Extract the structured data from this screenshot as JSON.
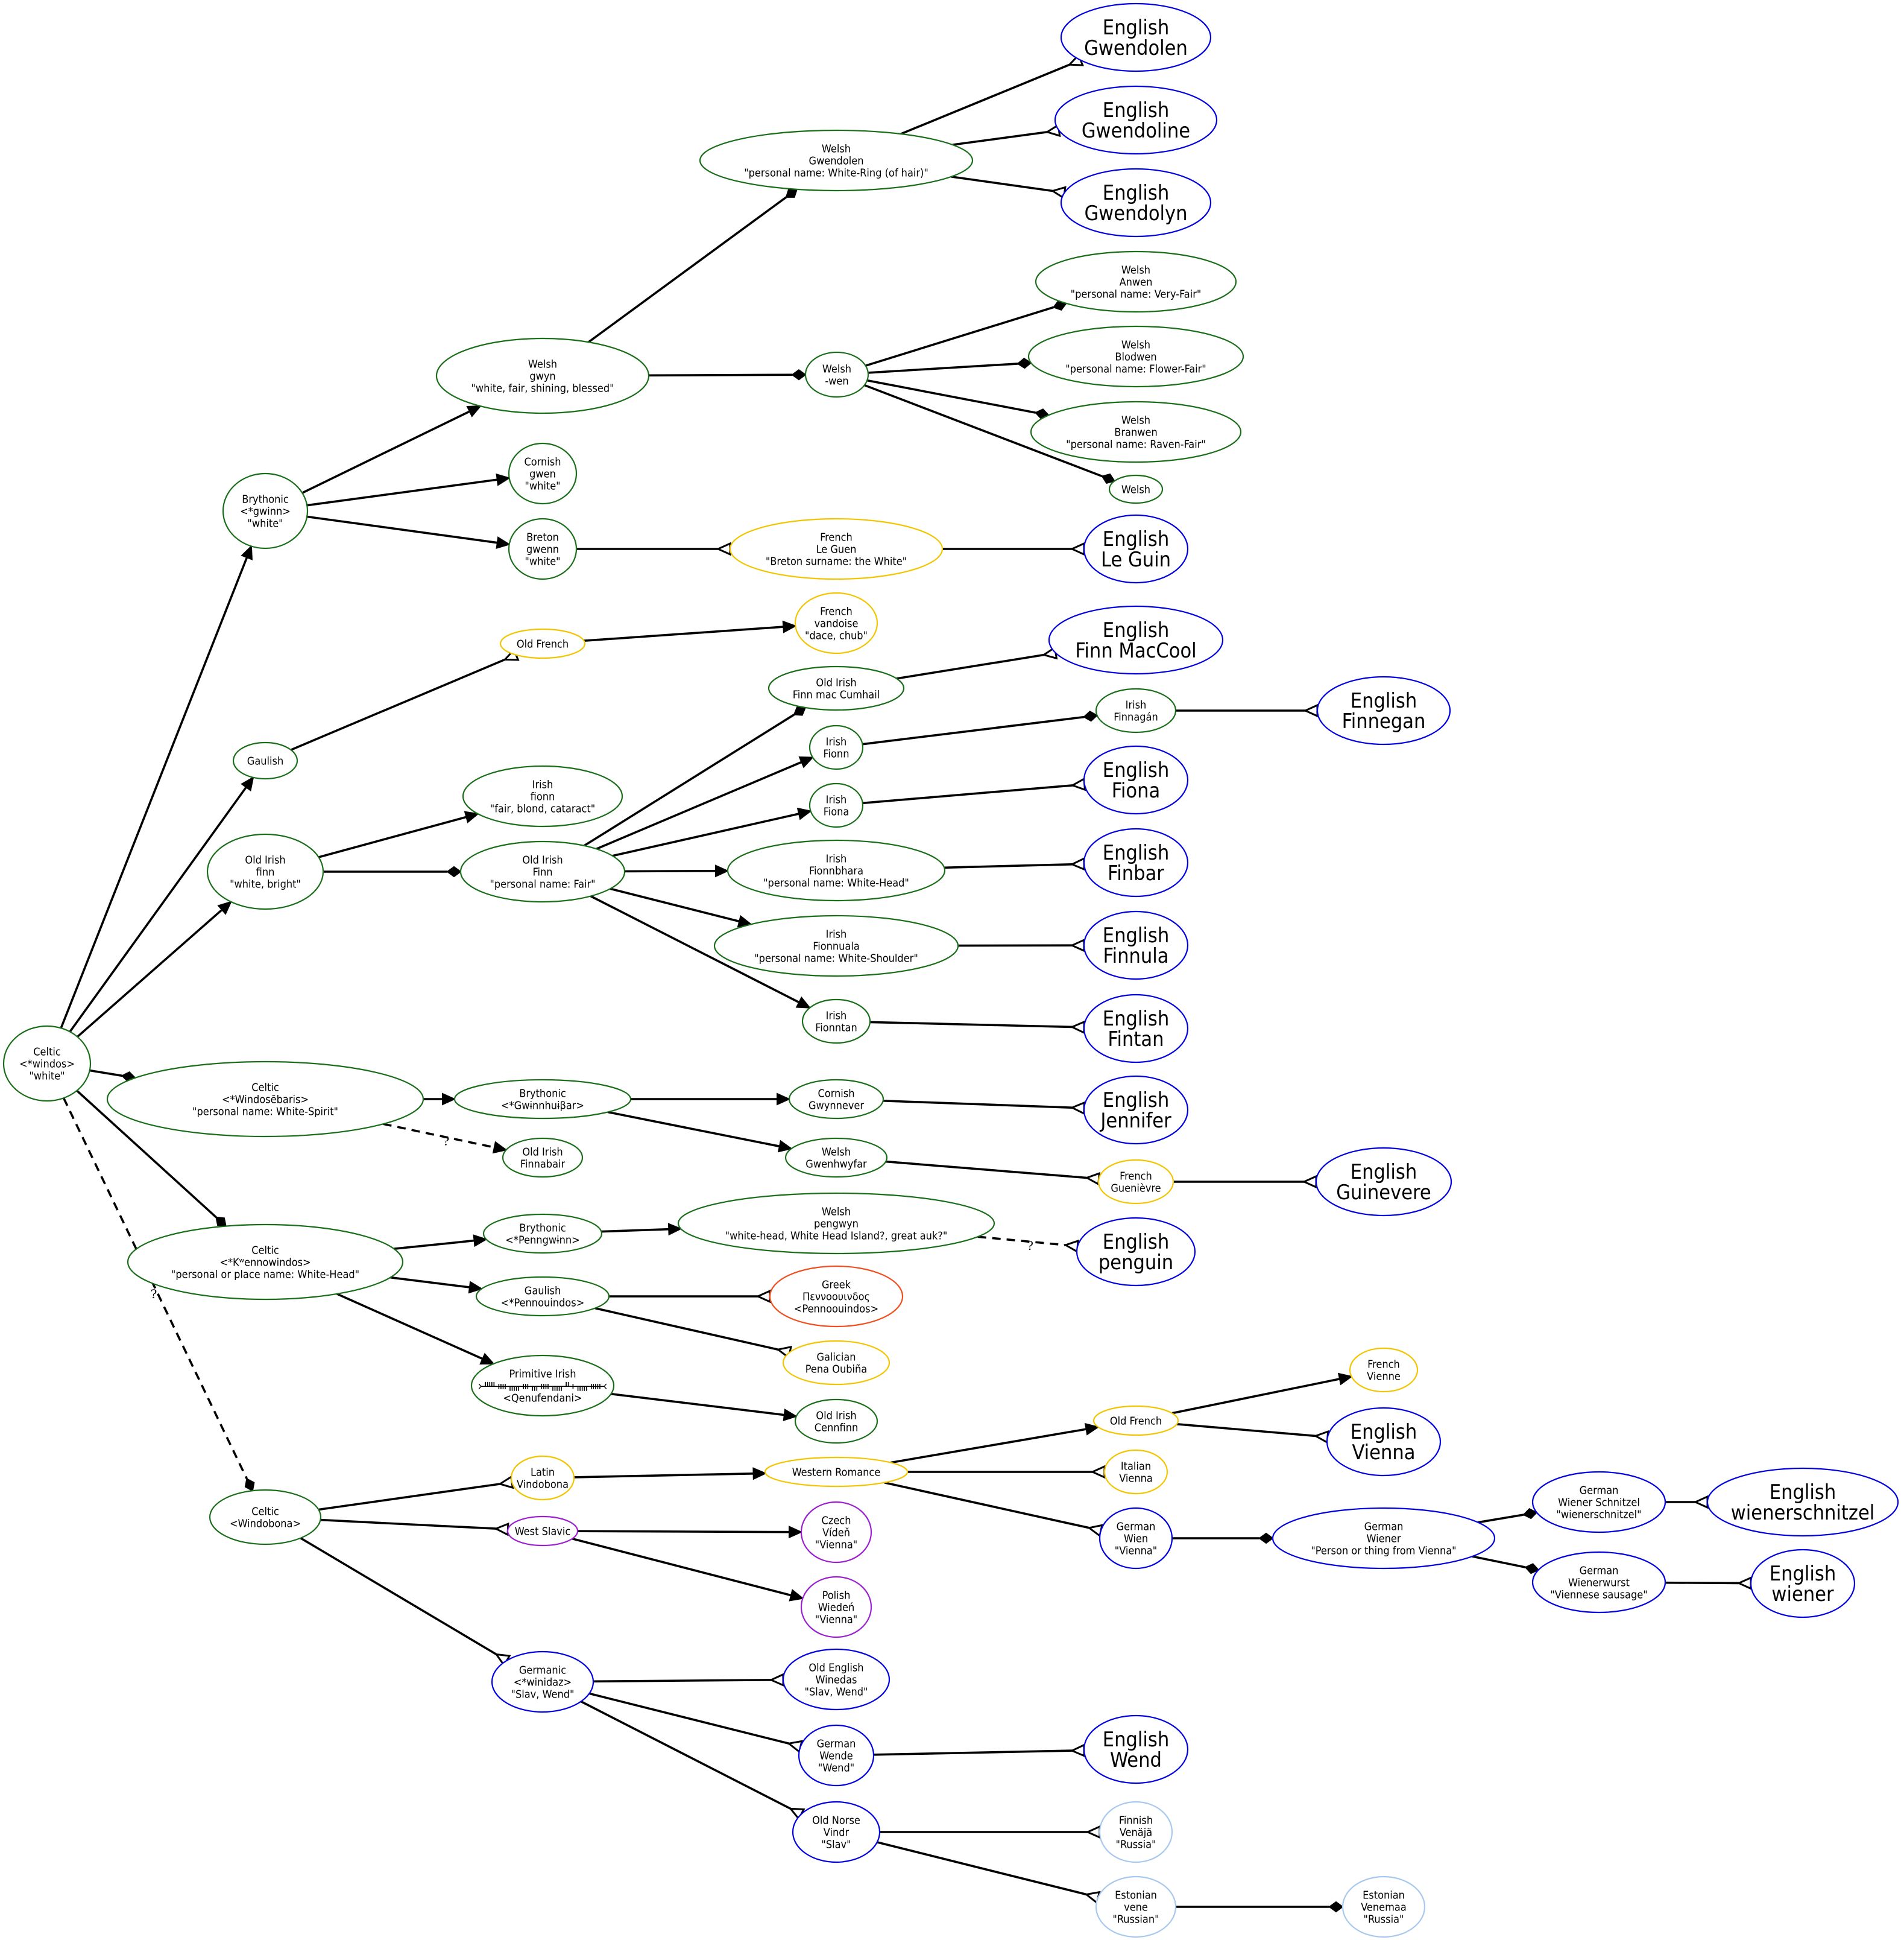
{
  "colors": {
    "celtic": "#1a6e1a",
    "romance": "#f2c500",
    "germanic": "#0000e0",
    "slavic": "#9b1fd0",
    "greek": "#f05020",
    "finnic": "#a8c8ee",
    "edge": "#000000"
  },
  "nodes": [
    {
      "id": "celtic_windos",
      "group": "celtic",
      "lines": [
        "Celtic",
        "<*windos>",
        "\"white\""
      ]
    },
    {
      "id": "bry_gwinn",
      "group": "celtic",
      "lines": [
        "Brythonic",
        "<*gwinn>",
        "\"white\""
      ]
    },
    {
      "id": "gaulish",
      "group": "celtic",
      "lines": [
        "Gaulish"
      ]
    },
    {
      "id": "oi_finn",
      "group": "celtic",
      "lines": [
        "Old Irish",
        "finn",
        "\"white, bright\""
      ]
    },
    {
      "id": "celtic_windoseb",
      "group": "celtic",
      "lines": [
        "Celtic",
        "<*Windosēbaris>",
        "\"personal name: White-Spirit\""
      ]
    },
    {
      "id": "celtic_kwenno",
      "group": "celtic",
      "lines": [
        "Celtic",
        "<*Kʷennowindos>",
        "\"personal or place name: White-Head\""
      ]
    },
    {
      "id": "celtic_windobona",
      "group": "celtic",
      "lines": [
        "Celtic",
        "<Windobona>"
      ]
    },
    {
      "id": "welsh_gwyn",
      "group": "celtic",
      "lines": [
        "Welsh",
        "gwyn",
        "\"white, fair, shining, blessed\""
      ]
    },
    {
      "id": "cornish_gwen",
      "group": "celtic",
      "lines": [
        "Cornish",
        "gwen",
        "\"white\""
      ]
    },
    {
      "id": "breton_gwenn",
      "group": "celtic",
      "lines": [
        "Breton",
        "gwenn",
        "\"white\""
      ]
    },
    {
      "id": "welsh_gwendolen",
      "group": "celtic",
      "lines": [
        "Welsh",
        "Gwendolen",
        "\"personal name: White-Ring (of hair)\""
      ]
    },
    {
      "id": "welsh_wen",
      "group": "celtic",
      "lines": [
        "Welsh",
        "-wen"
      ]
    },
    {
      "id": "eng_gwendolen",
      "group": "germanic",
      "big": true,
      "lines": [
        "English",
        "Gwendolen"
      ]
    },
    {
      "id": "eng_gwendoline",
      "group": "germanic",
      "big": true,
      "lines": [
        "English",
        "Gwendoline"
      ]
    },
    {
      "id": "eng_gwendolyn",
      "group": "germanic",
      "big": true,
      "lines": [
        "English",
        "Gwendolyn"
      ]
    },
    {
      "id": "welsh_anwen",
      "group": "celtic",
      "lines": [
        "Welsh",
        "Anwen",
        "\"personal name: Very-Fair\""
      ]
    },
    {
      "id": "welsh_blodwen",
      "group": "celtic",
      "lines": [
        "Welsh",
        "Blodwen",
        "\"personal name: Flower-Fair\""
      ]
    },
    {
      "id": "welsh_branwen",
      "group": "celtic",
      "lines": [
        "Welsh",
        "Branwen",
        "\"personal name: Raven-Fair\""
      ]
    },
    {
      "id": "welsh_plain",
      "group": "celtic",
      "lines": [
        "Welsh"
      ]
    },
    {
      "id": "french_leguen",
      "group": "romance",
      "lines": [
        "French",
        "Le Guen",
        "\"Breton surname: the White\""
      ]
    },
    {
      "id": "eng_leguin",
      "group": "germanic",
      "big": true,
      "lines": [
        "English",
        "Le Guin"
      ]
    },
    {
      "id": "ofr_1",
      "group": "romance",
      "lines": [
        "Old French"
      ]
    },
    {
      "id": "fr_vandoise",
      "group": "romance",
      "lines": [
        "French",
        "vandoise",
        "\"dace, chub\""
      ]
    },
    {
      "id": "irish_fionn_adj",
      "group": "celtic",
      "lines": [
        "Irish",
        "fionn",
        "\"fair, blond, cataract\""
      ]
    },
    {
      "id": "oi_Finn",
      "group": "celtic",
      "lines": [
        "Old Irish",
        "Finn",
        "\"personal name: Fair\""
      ]
    },
    {
      "id": "oi_finnmac",
      "group": "celtic",
      "lines": [
        "Old Irish",
        "Finn mac Cumhail"
      ]
    },
    {
      "id": "irish_fionn",
      "group": "celtic",
      "lines": [
        "Irish",
        "Fionn"
      ]
    },
    {
      "id": "irish_fiona",
      "group": "celtic",
      "lines": [
        "Irish",
        "Fiona"
      ]
    },
    {
      "id": "irish_fionnbhara",
      "group": "celtic",
      "lines": [
        "Irish",
        "Fionnbhara",
        "\"personal name: White-Head\""
      ]
    },
    {
      "id": "irish_fionnuala",
      "group": "celtic",
      "lines": [
        "Irish",
        "Fionnuala",
        "\"personal name: White-Shoulder\""
      ]
    },
    {
      "id": "irish_fionntan",
      "group": "celtic",
      "lines": [
        "Irish",
        "Fionntan"
      ]
    },
    {
      "id": "eng_finnmaccool",
      "group": "germanic",
      "big": true,
      "lines": [
        "English",
        "Finn MacCool"
      ]
    },
    {
      "id": "irish_finnagan",
      "group": "celtic",
      "lines": [
        "Irish",
        "Finnagán"
      ]
    },
    {
      "id": "eng_finnegan",
      "group": "germanic",
      "big": true,
      "lines": [
        "English",
        "Finnegan"
      ]
    },
    {
      "id": "eng_fiona",
      "group": "germanic",
      "big": true,
      "lines": [
        "English",
        "Fiona"
      ]
    },
    {
      "id": "eng_finbar",
      "group": "germanic",
      "big": true,
      "lines": [
        "English",
        "Finbar"
      ]
    },
    {
      "id": "eng_finnula",
      "group": "germanic",
      "big": true,
      "lines": [
        "English",
        "Finnula"
      ]
    },
    {
      "id": "eng_fintan",
      "group": "germanic",
      "big": true,
      "lines": [
        "English",
        "Fintan"
      ]
    },
    {
      "id": "bry_gwinnhuibar",
      "group": "celtic",
      "lines": [
        "Brythonic",
        "<*Gwɨnnhuɨβar>"
      ]
    },
    {
      "id": "oi_finnabair",
      "group": "celtic",
      "lines": [
        "Old Irish",
        "Finnabair"
      ]
    },
    {
      "id": "cornish_gwynnever",
      "group": "celtic",
      "lines": [
        "Cornish",
        "Gwynnever"
      ]
    },
    {
      "id": "welsh_gwenhwyfar",
      "group": "celtic",
      "lines": [
        "Welsh",
        "Gwenhwyfar"
      ]
    },
    {
      "id": "eng_jennifer",
      "group": "germanic",
      "big": true,
      "lines": [
        "English",
        "Jennifer"
      ]
    },
    {
      "id": "fr_guenievre",
      "group": "romance",
      "lines": [
        "French",
        "Guenièvre"
      ]
    },
    {
      "id": "eng_guinevere",
      "group": "germanic",
      "big": true,
      "lines": [
        "English",
        "Guinevere"
      ]
    },
    {
      "id": "bry_penngwinn",
      "group": "celtic",
      "lines": [
        "Brythonic",
        "<*Penngwɨnn>"
      ]
    },
    {
      "id": "welsh_pengwyn",
      "group": "celtic",
      "lines": [
        "Welsh",
        "pengwyn",
        "\"white-head, White Head Island?, great auk?\""
      ]
    },
    {
      "id": "eng_penguin",
      "group": "germanic",
      "big": true,
      "lines": [
        "English",
        "penguin"
      ]
    },
    {
      "id": "gaulish_pennouindos",
      "group": "celtic",
      "lines": [
        "Gaulish",
        "<*Pennouindos>"
      ]
    },
    {
      "id": "greek_pennoouindos",
      "group": "greek",
      "lines": [
        "Greek",
        "Πεννοουινδος",
        "<Pennoouindos>"
      ]
    },
    {
      "id": "galician_pena",
      "group": "romance",
      "lines": [
        "Galician",
        "Pena Oubiña"
      ]
    },
    {
      "id": "prim_irish",
      "group": "celtic",
      "lines": [
        "Primitive Irish",
        "᚛ᚊᚓᚅᚒᚃᚓᚅᚇᚐᚅᚔ᚜",
        "<Qenufendani>"
      ]
    },
    {
      "id": "oi_cennfinn",
      "group": "celtic",
      "lines": [
        "Old Irish",
        "Cennfinn"
      ]
    },
    {
      "id": "latin_vindobona",
      "group": "romance",
      "lines": [
        "Latin",
        "Vindobona"
      ]
    },
    {
      "id": "west_slavic",
      "group": "slavic",
      "lines": [
        "West Slavic"
      ]
    },
    {
      "id": "germanic_winidaz",
      "group": "germanic",
      "lines": [
        "Germanic",
        "<*winidaz>",
        "\"Slav, Wend\""
      ]
    },
    {
      "id": "western_romance",
      "group": "romance",
      "lines": [
        "Western Romance"
      ]
    },
    {
      "id": "czech_viden",
      "group": "slavic",
      "lines": [
        "Czech",
        "Vídeň",
        "\"Vienna\""
      ]
    },
    {
      "id": "polish_wieden",
      "group": "slavic",
      "lines": [
        "Polish",
        "Wiedeń",
        "\"Vienna\""
      ]
    },
    {
      "id": "ofr_2",
      "group": "romance",
      "lines": [
        "Old French"
      ]
    },
    {
      "id": "italian_vienna",
      "group": "romance",
      "lines": [
        "Italian",
        "Vienna"
      ]
    },
    {
      "id": "german_wien",
      "group": "germanic",
      "lines": [
        "German",
        "Wien",
        "\"Vienna\""
      ]
    },
    {
      "id": "fr_vienne",
      "group": "romance",
      "lines": [
        "French",
        "Vienne"
      ]
    },
    {
      "id": "eng_vienna",
      "group": "germanic",
      "big": true,
      "lines": [
        "English",
        "Vienna"
      ]
    },
    {
      "id": "german_wiener",
      "group": "germanic",
      "lines": [
        "German",
        "Wiener",
        "\"Person or thing from Vienna\""
      ]
    },
    {
      "id": "german_schnitzel",
      "group": "germanic",
      "lines": [
        "German",
        "Wiener Schnitzel",
        "\"wienerschnitzel\""
      ]
    },
    {
      "id": "german_wienerwurst",
      "group": "germanic",
      "lines": [
        "German",
        "Wienerwurst",
        "\"Viennese sausage\""
      ]
    },
    {
      "id": "eng_wienerschnitzel",
      "group": "germanic",
      "big": true,
      "lines": [
        "English",
        "wienerschnitzel"
      ]
    },
    {
      "id": "eng_wiener",
      "group": "germanic",
      "big": true,
      "lines": [
        "English",
        "wiener"
      ]
    },
    {
      "id": "oe_winedas",
      "group": "germanic",
      "lines": [
        "Old English",
        "Winedas",
        "\"Slav, Wend\""
      ]
    },
    {
      "id": "german_wende",
      "group": "germanic",
      "lines": [
        "German",
        "Wende",
        "\"Wend\""
      ]
    },
    {
      "id": "on_vindr",
      "group": "germanic",
      "lines": [
        "Old Norse",
        "Vindr",
        "\"Slav\""
      ]
    },
    {
      "id": "eng_wend",
      "group": "germanic",
      "big": true,
      "lines": [
        "English",
        "Wend"
      ]
    },
    {
      "id": "finnish_venaja",
      "group": "finnic",
      "lines": [
        "Finnish",
        "Venäjä",
        "\"Russia\""
      ]
    },
    {
      "id": "estonian_vene",
      "group": "finnic",
      "lines": [
        "Estonian",
        "vene",
        "\"Russian\""
      ]
    },
    {
      "id": "estonian_venemaa",
      "group": "finnic",
      "lines": [
        "Estonian",
        "Venemaa",
        "\"Russia\""
      ]
    }
  ],
  "edges": [
    {
      "from": "celtic_windos",
      "to": "bry_gwinn",
      "head": "normal"
    },
    {
      "from": "celtic_windos",
      "to": "gaulish",
      "head": "normal"
    },
    {
      "from": "celtic_windos",
      "to": "oi_finn",
      "head": "normal"
    },
    {
      "from": "celtic_windos",
      "to": "celtic_windoseb",
      "head": "diamond"
    },
    {
      "from": "celtic_windos",
      "to": "celtic_kwenno",
      "head": "diamond"
    },
    {
      "from": "celtic_windos",
      "to": "celtic_windobona",
      "head": "diamond",
      "style": "dashed",
      "label": "?"
    },
    {
      "from": "bry_gwinn",
      "to": "welsh_gwyn",
      "head": "normal"
    },
    {
      "from": "bry_gwinn",
      "to": "cornish_gwen",
      "head": "normal"
    },
    {
      "from": "bry_gwinn",
      "to": "breton_gwenn",
      "head": "normal"
    },
    {
      "from": "welsh_gwyn",
      "to": "welsh_gwendolen",
      "head": "diamond"
    },
    {
      "from": "welsh_gwyn",
      "to": "welsh_wen",
      "head": "diamond"
    },
    {
      "from": "welsh_gwendolen",
      "to": "eng_gwendolen",
      "head": "crow"
    },
    {
      "from": "welsh_gwendolen",
      "to": "eng_gwendoline",
      "head": "crow"
    },
    {
      "from": "welsh_gwendolen",
      "to": "eng_gwendolyn",
      "head": "crow"
    },
    {
      "from": "welsh_wen",
      "to": "welsh_anwen",
      "head": "diamond"
    },
    {
      "from": "welsh_wen",
      "to": "welsh_blodwen",
      "head": "diamond"
    },
    {
      "from": "welsh_wen",
      "to": "welsh_branwen",
      "head": "diamond"
    },
    {
      "from": "welsh_wen",
      "to": "welsh_plain",
      "head": "diamond"
    },
    {
      "from": "breton_gwenn",
      "to": "french_leguen",
      "head": "crow"
    },
    {
      "from": "french_leguen",
      "to": "eng_leguin",
      "head": "crow"
    },
    {
      "from": "gaulish",
      "to": "ofr_1",
      "head": "crow"
    },
    {
      "from": "ofr_1",
      "to": "fr_vandoise",
      "head": "normal"
    },
    {
      "from": "oi_finn",
      "to": "irish_fionn_adj",
      "head": "normal"
    },
    {
      "from": "oi_finn",
      "to": "oi_Finn",
      "head": "diamond"
    },
    {
      "from": "oi_Finn",
      "to": "oi_finnmac",
      "head": "diamond"
    },
    {
      "from": "oi_Finn",
      "to": "irish_fionn",
      "head": "normal"
    },
    {
      "from": "oi_Finn",
      "to": "irish_fiona",
      "head": "normal"
    },
    {
      "from": "oi_Finn",
      "to": "irish_fionnbhara",
      "head": "normal"
    },
    {
      "from": "oi_Finn",
      "to": "irish_fionnuala",
      "head": "normal"
    },
    {
      "from": "oi_Finn",
      "to": "irish_fionntan",
      "head": "normal"
    },
    {
      "from": "oi_finnmac",
      "to": "eng_finnmaccool",
      "head": "crow"
    },
    {
      "from": "irish_fionn",
      "to": "irish_finnagan",
      "head": "diamond"
    },
    {
      "from": "irish_finnagan",
      "to": "eng_finnegan",
      "head": "crow"
    },
    {
      "from": "irish_fiona",
      "to": "eng_fiona",
      "head": "crow"
    },
    {
      "from": "irish_fionnbhara",
      "to": "eng_finbar",
      "head": "crow"
    },
    {
      "from": "irish_fionnuala",
      "to": "eng_finnula",
      "head": "crow"
    },
    {
      "from": "irish_fionntan",
      "to": "eng_fintan",
      "head": "crow"
    },
    {
      "from": "celtic_windoseb",
      "to": "bry_gwinnhuibar",
      "head": "normal"
    },
    {
      "from": "celtic_windoseb",
      "to": "oi_finnabair",
      "head": "normal",
      "style": "dashed",
      "label": "?"
    },
    {
      "from": "bry_gwinnhuibar",
      "to": "cornish_gwynnever",
      "head": "normal"
    },
    {
      "from": "bry_gwinnhuibar",
      "to": "welsh_gwenhwyfar",
      "head": "normal"
    },
    {
      "from": "cornish_gwynnever",
      "to": "eng_jennifer",
      "head": "crow"
    },
    {
      "from": "welsh_gwenhwyfar",
      "to": "fr_guenievre",
      "head": "crow"
    },
    {
      "from": "fr_guenievre",
      "to": "eng_guinevere",
      "head": "crow"
    },
    {
      "from": "celtic_kwenno",
      "to": "bry_penngwinn",
      "head": "normal"
    },
    {
      "from": "celtic_kwenno",
      "to": "gaulish_pennouindos",
      "head": "normal"
    },
    {
      "from": "celtic_kwenno",
      "to": "prim_irish",
      "head": "normal"
    },
    {
      "from": "bry_penngwinn",
      "to": "welsh_pengwyn",
      "head": "normal"
    },
    {
      "from": "welsh_pengwyn",
      "to": "eng_penguin",
      "head": "crow",
      "style": "dashed",
      "label": "?"
    },
    {
      "from": "gaulish_pennouindos",
      "to": "greek_pennoouindos",
      "head": "crow"
    },
    {
      "from": "gaulish_pennouindos",
      "to": "galician_pena",
      "head": "crow"
    },
    {
      "from": "prim_irish",
      "to": "oi_cennfinn",
      "head": "normal"
    },
    {
      "from": "celtic_windobona",
      "to": "latin_vindobona",
      "head": "crow"
    },
    {
      "from": "celtic_windobona",
      "to": "west_slavic",
      "head": "crow"
    },
    {
      "from": "celtic_windobona",
      "to": "germanic_winidaz",
      "head": "crow"
    },
    {
      "from": "latin_vindobona",
      "to": "western_romance",
      "head": "normal"
    },
    {
      "from": "west_slavic",
      "to": "czech_viden",
      "head": "normal"
    },
    {
      "from": "west_slavic",
      "to": "polish_wieden",
      "head": "normal"
    },
    {
      "from": "western_romance",
      "to": "ofr_2",
      "head": "normal"
    },
    {
      "from": "western_romance",
      "to": "italian_vienna",
      "head": "crow"
    },
    {
      "from": "western_romance",
      "to": "german_wien",
      "head": "crow"
    },
    {
      "from": "ofr_2",
      "to": "fr_vienne",
      "head": "normal"
    },
    {
      "from": "ofr_2",
      "to": "eng_vienna",
      "head": "crow"
    },
    {
      "from": "german_wien",
      "to": "german_wiener",
      "head": "diamond"
    },
    {
      "from": "german_wiener",
      "to": "german_schnitzel",
      "head": "diamond"
    },
    {
      "from": "german_wiener",
      "to": "german_wienerwurst",
      "head": "diamond"
    },
    {
      "from": "german_schnitzel",
      "to": "eng_wienerschnitzel",
      "head": "crow"
    },
    {
      "from": "german_wienerwurst",
      "to": "eng_wiener",
      "head": "crow"
    },
    {
      "from": "germanic_winidaz",
      "to": "oe_winedas",
      "head": "crow"
    },
    {
      "from": "germanic_winidaz",
      "to": "german_wende",
      "head": "crow"
    },
    {
      "from": "germanic_winidaz",
      "to": "on_vindr",
      "head": "crow"
    },
    {
      "from": "german_wende",
      "to": "eng_wend",
      "head": "crow"
    },
    {
      "from": "on_vindr",
      "to": "finnish_venaja",
      "head": "crow"
    },
    {
      "from": "on_vindr",
      "to": "estonian_vene",
      "head": "crow"
    },
    {
      "from": "estonian_vene",
      "to": "estonian_venemaa",
      "head": "diamond"
    }
  ]
}
